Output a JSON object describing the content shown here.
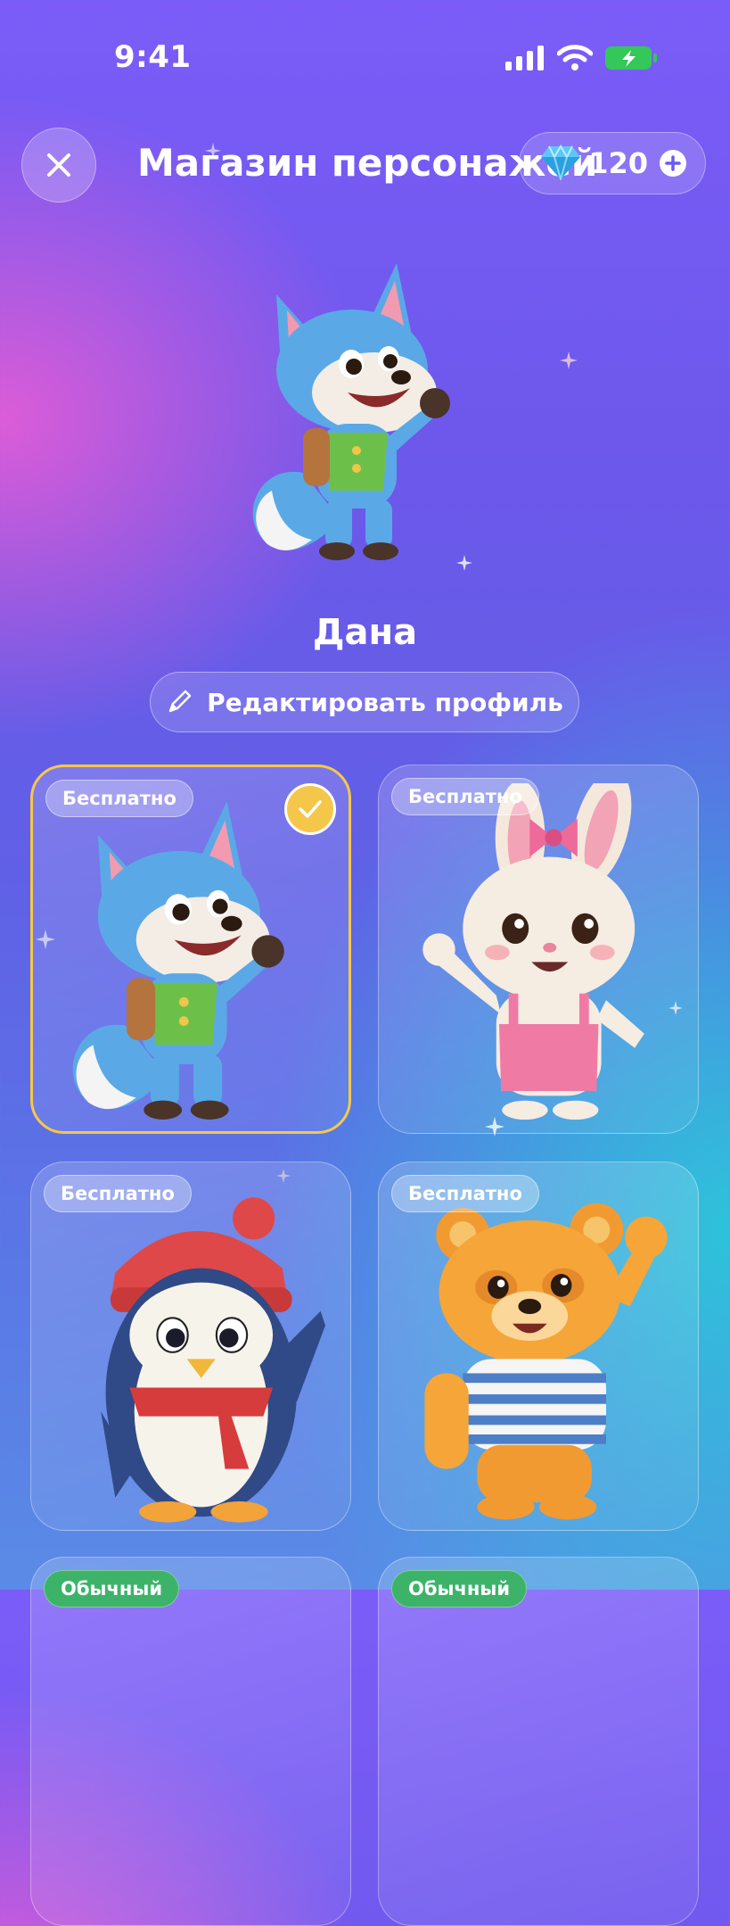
{
  "status_bar": {
    "time": "9:41"
  },
  "header": {
    "title": "Магазин персонажей",
    "gems_count": "120"
  },
  "profile": {
    "name": "Дана",
    "edit_label": "Редактировать профиль"
  },
  "characters": [
    {
      "animal": "fox",
      "badge": "Бесплатно",
      "selected": true
    },
    {
      "animal": "bunny",
      "badge": "Бесплатно",
      "selected": false
    },
    {
      "animal": "penguin",
      "badge": "Бесплатно",
      "selected": false
    },
    {
      "animal": "bear",
      "badge": "Бесплатно",
      "selected": false
    },
    {
      "animal": "partial",
      "badge": "Обычный",
      "selected": false
    },
    {
      "animal": "partial",
      "badge": "Обычный",
      "selected": false
    }
  ],
  "colors": {
    "selected_border": "#f4c84a",
    "badge_green": "#3db36a",
    "battery": "#34c759"
  }
}
